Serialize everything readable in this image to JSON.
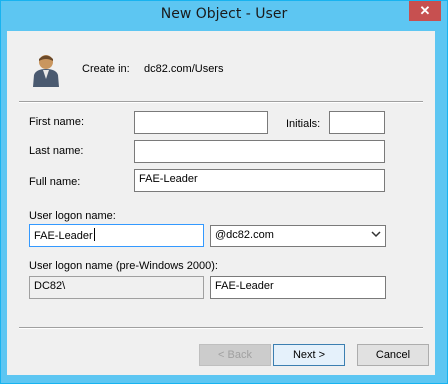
{
  "window": {
    "title": "New Object - User",
    "close_glyph": "✕"
  },
  "create_in": {
    "label": "Create in:",
    "path": "dc82.com/Users"
  },
  "form": {
    "first_name_label": "First name:",
    "first_name_value": "",
    "initials_label": "Initials:",
    "initials_value": "",
    "last_name_label": "Last name:",
    "last_name_value": "",
    "full_name_label": "Full name:",
    "full_name_value": "FAE-Leader",
    "logon_label": "User logon name:",
    "logon_value": "FAE-Leader",
    "domain_value": "@dc82.com",
    "pre2000_label": "User logon name (pre-Windows 2000):",
    "pre2000_domain": "DC82\\",
    "pre2000_value": "FAE-Leader"
  },
  "buttons": {
    "back": "< Back",
    "next": "Next >",
    "cancel": "Cancel"
  },
  "icons": {
    "user": "user-icon",
    "close": "close-icon",
    "dropdown": "chevron-down-icon"
  }
}
